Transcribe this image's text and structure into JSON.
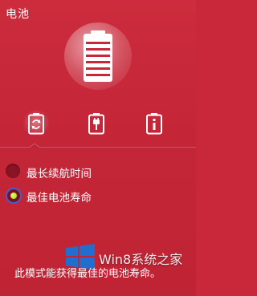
{
  "panel": {
    "title": "电池"
  },
  "modes": {
    "items": [
      {
        "name": "auto-mode",
        "active": true
      },
      {
        "name": "battery-plug-mode",
        "active": false
      },
      {
        "name": "battery-info-mode",
        "active": false
      }
    ]
  },
  "options": [
    {
      "label": "最长续航时间",
      "selected": false
    },
    {
      "label": "最佳电池寿命",
      "selected": true
    }
  ],
  "description": "此模式能获得最佳的电池寿命。",
  "watermark": {
    "text": "Win8系统之家"
  },
  "colors": {
    "background": "#c8283a",
    "radio_selected_dot": "#b8e820",
    "radio_selected_ring": "#4a5cc8"
  }
}
